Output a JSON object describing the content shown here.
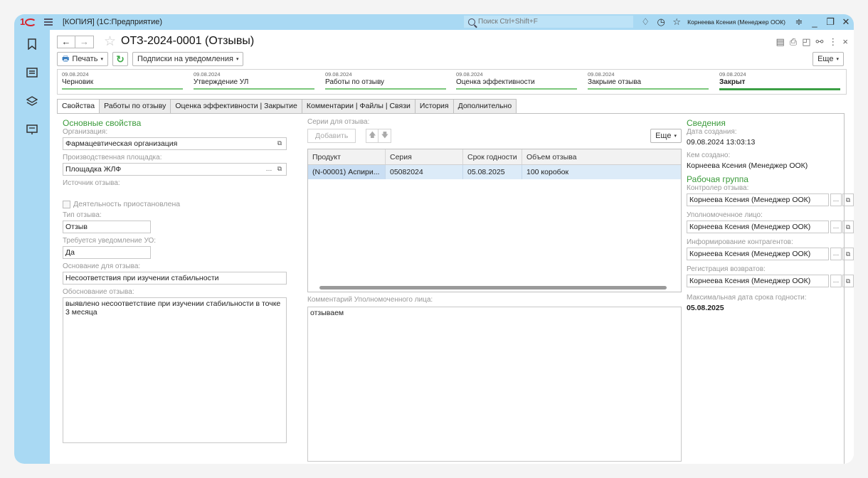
{
  "window": {
    "title": "[КОПИЯ]  (1С:Предприятие)",
    "search_placeholder": "Поиск Ctrl+Shift+F",
    "user": "Корнеева Ксения (Менеджер ООК)"
  },
  "doc": {
    "title": "ОТЗ-2024-0001 (Отзывы)",
    "print_label": "Печать",
    "subscribe_label": "Подписки на уведомления",
    "more_label": "Еще"
  },
  "stages": [
    {
      "date": "09.08.2024",
      "name": "Черновик"
    },
    {
      "date": "09.08.2024",
      "name": "Утверждение УЛ"
    },
    {
      "date": "09.08.2024",
      "name": "Работы по отзыву"
    },
    {
      "date": "09.08.2024",
      "name": "Оценка эффективности"
    },
    {
      "date": "09.08.2024",
      "name": "Закрыие отзыва"
    },
    {
      "date": "09.08.2024",
      "name": "Закрыт"
    }
  ],
  "tabs": [
    "Свойства",
    "Работы по отзыву",
    "Оценка эффективности | Закрытие",
    "Комментарии | Файлы | Связи",
    "История",
    "Дополнительно"
  ],
  "main": {
    "section_title": "Основные свойства",
    "org_label": "Организация:",
    "org_value": "Фармацевтическая организация",
    "site_label": "Производственная площадка:",
    "site_value": "Площадка ЖЛФ",
    "source_label": "Источник отзыва:",
    "suspended_label": "Деятельность приостановлена",
    "type_label": "Тип отзыва:",
    "type_value": "Отзыв",
    "notify_label": "Требуется уведомление УО:",
    "notify_value": "Да",
    "basis_label": "Основание для отзыва:",
    "basis_value": "Несоответствия при изучении стабильности",
    "reason_label": "Обоснование отзыва:",
    "reason_value": "выявлено несоответствие при изучении стабильности в точке 3 месяца"
  },
  "series": {
    "label": "Серии для отзыва:",
    "add_label": "Добавить",
    "more_label": "Еще",
    "columns": [
      "Продукт",
      "Серия",
      "Срок годности",
      "Объем отзыва"
    ],
    "rows": [
      [
        "(N-00001) Аспири...",
        "05082024",
        "05.08.2025",
        "100 коробок"
      ]
    ],
    "comment_label": "Комментарий Уполномоченного лица:",
    "comment_value": "отзываем"
  },
  "info": {
    "section_title": "Сведения",
    "created_label": "Дата создания:",
    "created_value": "09.08.2024 13:03:13",
    "author_label": "Кем создано:",
    "author_value": "Корнеева Ксения (Менеджер ООК)",
    "group_title": "Рабочая группа",
    "controller_label": "Контролер отзыва:",
    "controller_value": "Корнеева Ксения (Менеджер ООК)",
    "qp_label": "Уполномоченное лицо:",
    "qp_value": "Корнеева Ксения (Менеджер ООК)",
    "partners_label": "Информирование контрагентов:",
    "partners_value": "Корнеева Ксения (Менеджер ООК)",
    "returns_label": "Регистрация возвратов:",
    "returns_value": "Корнеева Ксения (Менеджер ООК)",
    "maxexp_label": "Максимальная дата срока годности:",
    "maxexp_value": "05.08.2025"
  }
}
